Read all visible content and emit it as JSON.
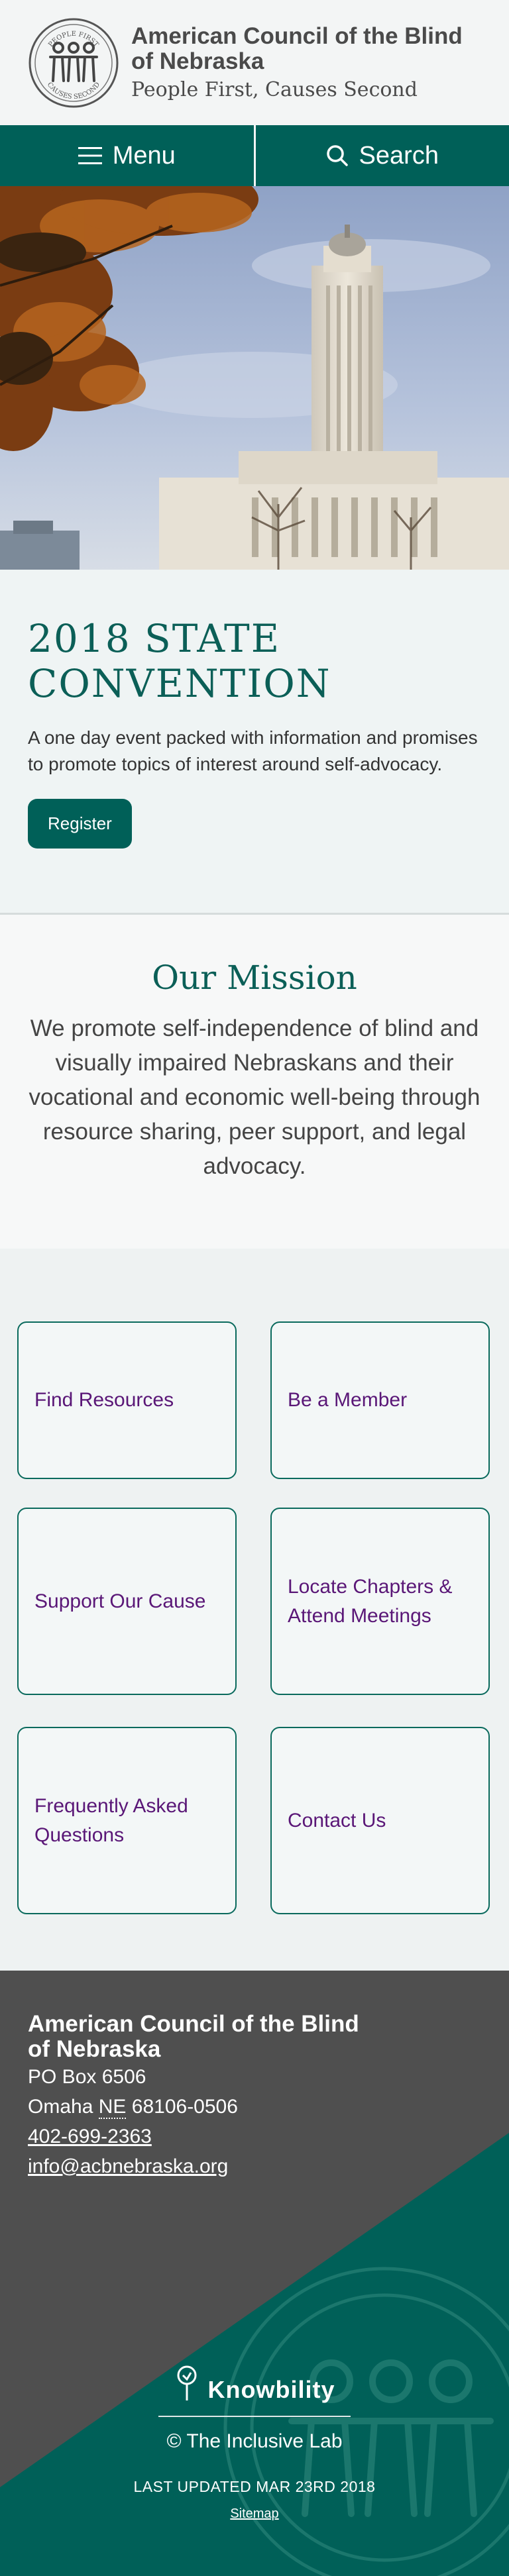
{
  "header": {
    "org_name_line1": "American Council of the Blind",
    "org_name_line2": "of Nebraska",
    "tagline": "People First, Causes Second",
    "logo_text_top": "PEOPLE FIRST",
    "logo_text_bottom": "CAUSES SECOND"
  },
  "nav": {
    "menu_label": "Menu",
    "search_label": "Search"
  },
  "hero": {
    "image": "nebraska-state-capitol-photo"
  },
  "convention": {
    "title_line1": "2018 STATE",
    "title_line2": "CONVENTION",
    "description": "A one day event packed with information and promises to promote topics of interest around self-advocacy.",
    "register_label": "Register"
  },
  "mission": {
    "heading": "Our Mission",
    "text": "We promote self-independence of blind and visually impaired Nebraskans and their vocational and economic well-being through resource sharing, peer support, and legal advocacy."
  },
  "cards": [
    "Find Resources",
    "Be a Member",
    "Support Our Cause",
    "Locate Chapters & Attend Meetings",
    "Frequently Asked Questions",
    "Contact Us"
  ],
  "footer": {
    "org_line1": "American Council of the Blind",
    "org_line2": "of Nebraska",
    "po_box": "PO Box 6506",
    "city": "Omaha",
    "state": "NE",
    "zip": "68106-0506",
    "phone": "402-699-2363",
    "email": "info@acbnebraska.org",
    "partner": "Knowbility",
    "copyright": "© The Inclusive Lab",
    "last_updated": "LAST UPDATED MAR 23RD 2018",
    "sitemap": "Sitemap"
  },
  "colors": {
    "brand_teal": "#006058",
    "card_text_purple": "#5a1777",
    "footer_gray": "#4f4f4f"
  }
}
